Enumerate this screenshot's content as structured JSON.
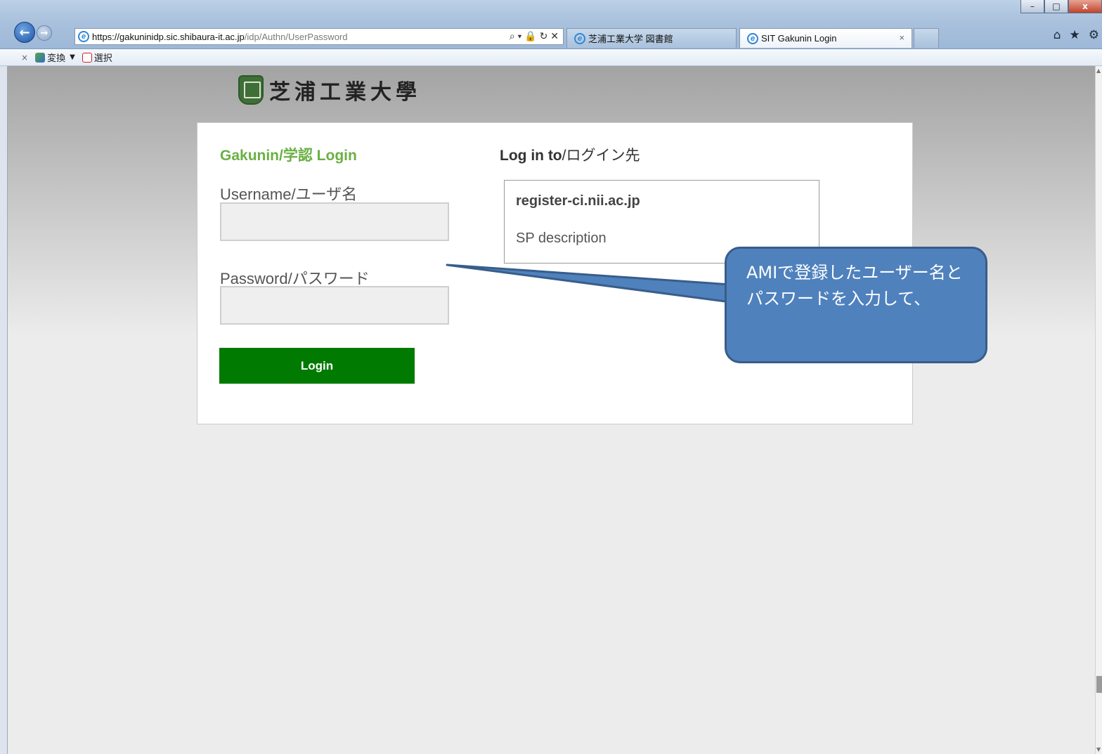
{
  "browser": {
    "url_host": "https://gakuninidp.sic.shibaura-it.ac.jp",
    "url_path": "/idp/Authn/UserPassword",
    "address_tools": "⌕ ▾ 🔒 ↻ ✕",
    "tabs": [
      {
        "title": "芝浦工業大学 図書館"
      },
      {
        "title": "SIT Gakunin Login"
      }
    ],
    "tab_close": "×",
    "window_controls": {
      "minimize": "–",
      "maximize": "□",
      "close": "x"
    },
    "toolbar_icons": [
      "home-icon",
      "favorites-icon",
      "settings-icon"
    ]
  },
  "commandbar": {
    "close_symbol": "×",
    "convert_label": "変換",
    "dropdown_symbol": "▼",
    "select_label": "選択"
  },
  "logo": {
    "text": "芝浦工業大學"
  },
  "login": {
    "title": "Gakunin/学認 Login",
    "username_label": "Username/ユーザ名",
    "username_value": "",
    "password_label": "Password/パスワード",
    "password_value": "",
    "button_label": "Login"
  },
  "destination": {
    "heading_bold": "Log in to",
    "heading_rest": "/ログイン先",
    "sp_name": "register-ci.nii.ac.jp",
    "sp_description": "SP description"
  },
  "callout": {
    "text": "AMIで登録したユーザー名とパスワードを入力して、"
  },
  "colors": {
    "accent_green": "#6ab043",
    "login_button": "#007a00",
    "callout_fill": "#4f81bd",
    "callout_border": "#385d8a"
  }
}
